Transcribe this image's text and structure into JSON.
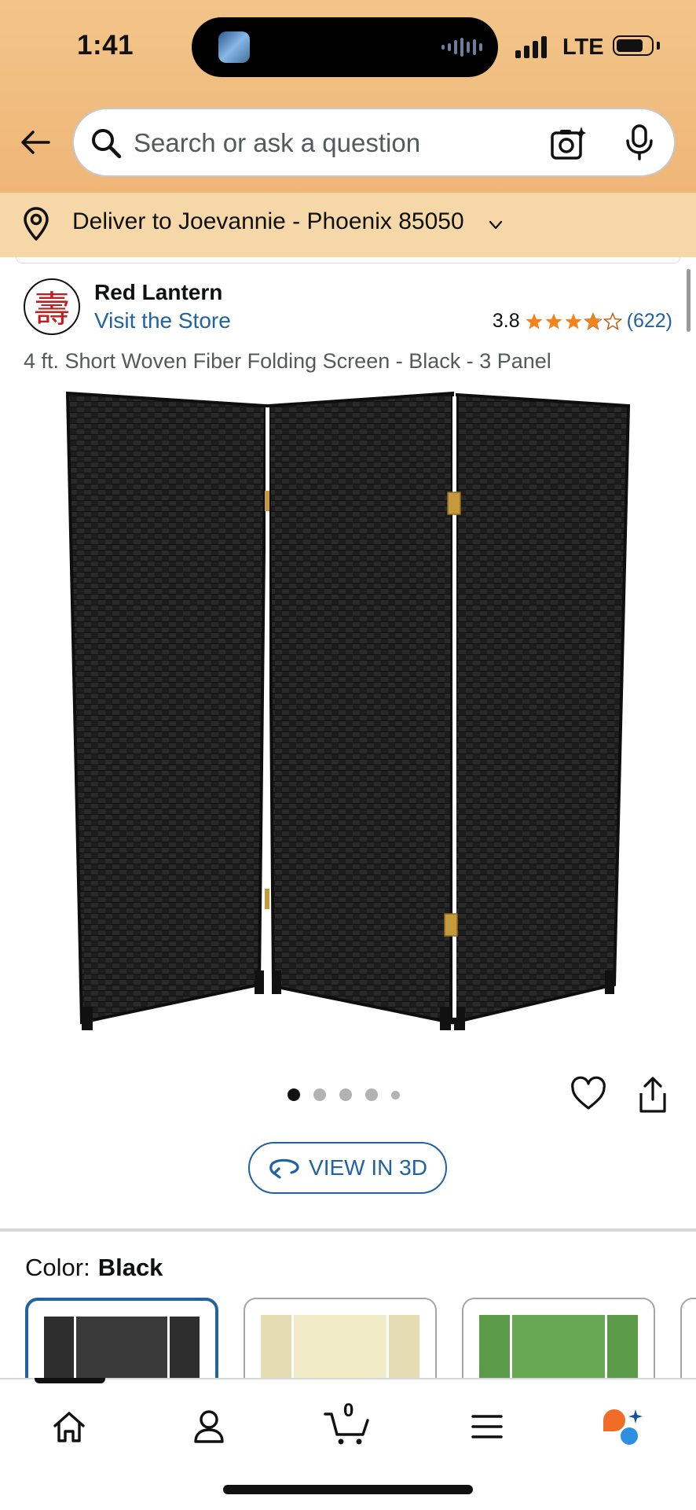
{
  "status_bar": {
    "time": "1:41",
    "network": "LTE"
  },
  "search": {
    "placeholder": "Search or ask a question"
  },
  "delivery": {
    "text": "Deliver to Joevannie - Phoenix 85050"
  },
  "brand": {
    "logo_glyph": "壽",
    "name": "Red Lantern",
    "visit_store": "Visit the Store"
  },
  "rating": {
    "value": "3.8",
    "stars": 3.8,
    "count": "(622)"
  },
  "product": {
    "title": "4 ft. Short Woven Fiber Folding Screen - Black - 3 Panel"
  },
  "gallery": {
    "image_count": 5,
    "active_index": 0
  },
  "view_3d": {
    "label": "VIEW IN 3D"
  },
  "color": {
    "label": "Color:",
    "selected": "Black"
  },
  "swatches": [
    {
      "name": "black-swatch",
      "color": "#2b2b2b",
      "selected": true
    },
    {
      "name": "natural-swatch",
      "color": "#efe6c4",
      "selected": false
    },
    {
      "name": "green-swatch",
      "color": "#5f9e4f",
      "selected": false
    }
  ],
  "bottom_nav": {
    "items": [
      "home",
      "account",
      "cart",
      "menu",
      "rufus"
    ],
    "active": "home",
    "cart_count": "0"
  },
  "colors": {
    "link": "#2162a1",
    "star": "#f3841c",
    "header": "#f0bd80",
    "deliver_bar": "#f6d7a8"
  }
}
